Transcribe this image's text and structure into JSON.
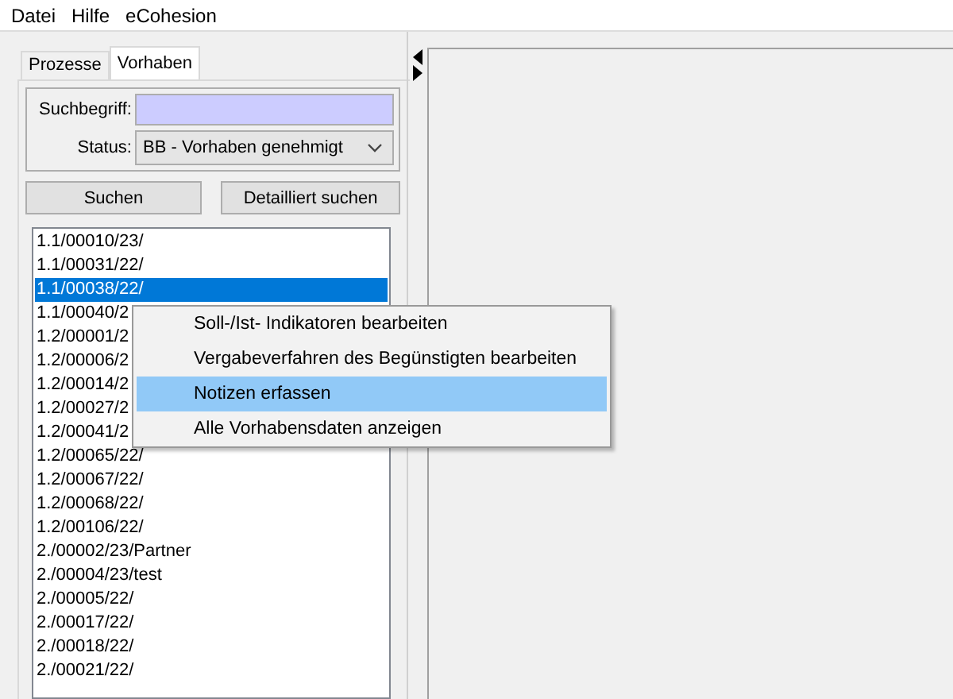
{
  "menu_bar": [
    "Datei",
    "Hilfe",
    "eCohesion"
  ],
  "tabs": [
    {
      "label": "Prozesse",
      "selected": false
    },
    {
      "label": "Vorhaben",
      "selected": true
    }
  ],
  "search": {
    "label": "Suchbegriff:"
  },
  "status": {
    "label": "Status:",
    "value": "BB - Vorhaben genehmigt"
  },
  "buttons": [
    "Suchen",
    "Detailliert suchen"
  ],
  "list": [
    {
      "text": "1.1/00010/23/",
      "selected": false
    },
    {
      "text": "1.1/00031/22/",
      "selected": false
    },
    {
      "text": "1.1/00038/22/",
      "selected": true
    },
    {
      "text": "1.1/00040/2",
      "selected": false
    },
    {
      "text": "1.2/00001/2",
      "selected": false
    },
    {
      "text": "1.2/00006/2",
      "selected": false
    },
    {
      "text": "1.2/00014/2",
      "selected": false
    },
    {
      "text": "1.2/00027/2",
      "selected": false
    },
    {
      "text": "1.2/00041/2",
      "selected": false
    },
    {
      "text": "1.2/00065/22/",
      "selected": false
    },
    {
      "text": "1.2/00067/22/",
      "selected": false
    },
    {
      "text": "1.2/00068/22/",
      "selected": false
    },
    {
      "text": "1.2/00106/22/",
      "selected": false
    },
    {
      "text": "2./00002/23/Partner",
      "selected": false
    },
    {
      "text": "2./00004/23/test",
      "selected": false
    },
    {
      "text": "2./00005/22/",
      "selected": false
    },
    {
      "text": "2./00017/22/",
      "selected": false
    },
    {
      "text": "2./00018/22/",
      "selected": false
    },
    {
      "text": "2./00021/22/",
      "selected": false
    }
  ],
  "context_menu": [
    {
      "label": "Soll-/Ist- Indikatoren bearbeiten",
      "selected": false
    },
    {
      "label": "Vergabeverfahren des Begünstigten bearbeiten",
      "selected": false
    },
    {
      "label": "Notizen erfassen",
      "selected": true
    },
    {
      "label": "Alle Vorhabensdaten anzeigen",
      "selected": false
    }
  ]
}
